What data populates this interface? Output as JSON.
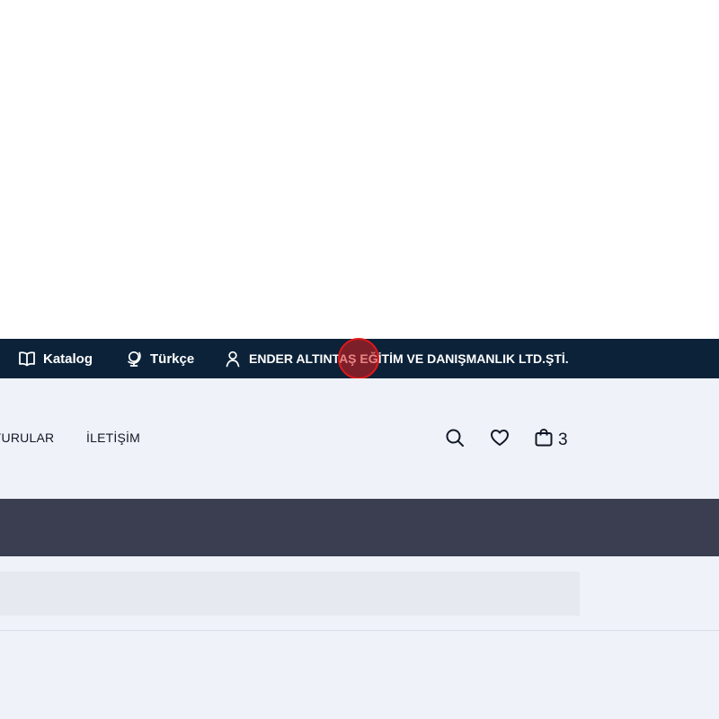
{
  "topbar": {
    "catalog_label": "Katalog",
    "language_label": "Türkçe",
    "account_label": "ENDER ALTINTAŞ EĞİTİM VE DANIŞMANLIK LTD.ŞTİ.",
    "catalog_icon": "book-open-icon",
    "language_icon": "globe-icon",
    "account_icon": "user-icon"
  },
  "nav": {
    "items": [
      {
        "label": "YURULAR"
      },
      {
        "label": "İLETİŞİM"
      }
    ],
    "search_icon": "search-icon",
    "wishlist_icon": "heart-icon",
    "cart_icon": "shopping-bag-icon",
    "cart_count": "3"
  },
  "colors": {
    "topbar_bg": "#0b2239",
    "nav_bg": "#eff2f8",
    "band_bg": "#3a3e50",
    "search_bg": "#e6eaf0",
    "click_marker": "#e01818"
  }
}
